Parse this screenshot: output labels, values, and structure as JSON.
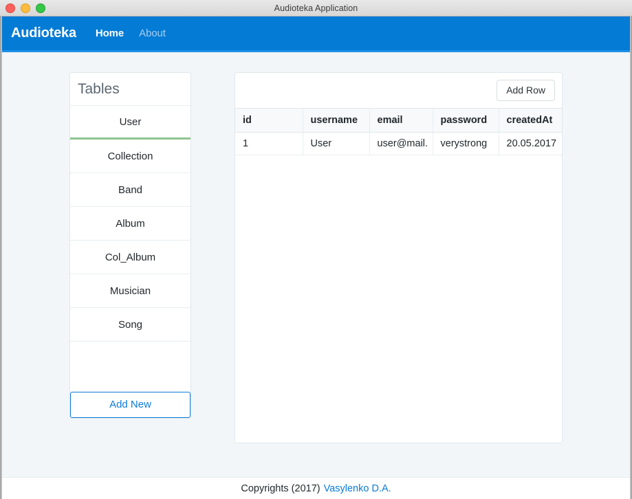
{
  "window": {
    "title": "Audioteka Application",
    "controls": [
      {
        "name": "close",
        "color": "#fc605c"
      },
      {
        "name": "minimize",
        "color": "#fdbc40"
      },
      {
        "name": "maximize",
        "color": "#34c749"
      }
    ]
  },
  "navbar": {
    "brand": "Audioteka",
    "background": "#047bd5",
    "links": [
      {
        "label": "Home",
        "active": true
      },
      {
        "label": "About",
        "active": false
      }
    ]
  },
  "sidebar": {
    "header": "Tables",
    "active_accent": "#8fc48f",
    "items": [
      {
        "label": "User",
        "active": true
      },
      {
        "label": "Collection",
        "active": false
      },
      {
        "label": "Band",
        "active": false
      },
      {
        "label": "Album",
        "active": false
      },
      {
        "label": "Col_Album",
        "active": false
      },
      {
        "label": "Musician",
        "active": false
      },
      {
        "label": "Song",
        "active": false
      }
    ],
    "add_new_label": "Add New",
    "add_new_color": "#0a7ad8"
  },
  "table_panel": {
    "add_row_label": "Add Row",
    "columns": [
      "id",
      "username",
      "email",
      "password",
      "createdAt"
    ],
    "rows": [
      {
        "id": "1",
        "username": "User",
        "email": "user@mail.",
        "password": "verystrong",
        "createdAt": "20.05.2017"
      }
    ]
  },
  "footer": {
    "text": "Copyrights (2017)",
    "link": "Vasylenko D.A.",
    "link_color": "#0a7ad8"
  }
}
